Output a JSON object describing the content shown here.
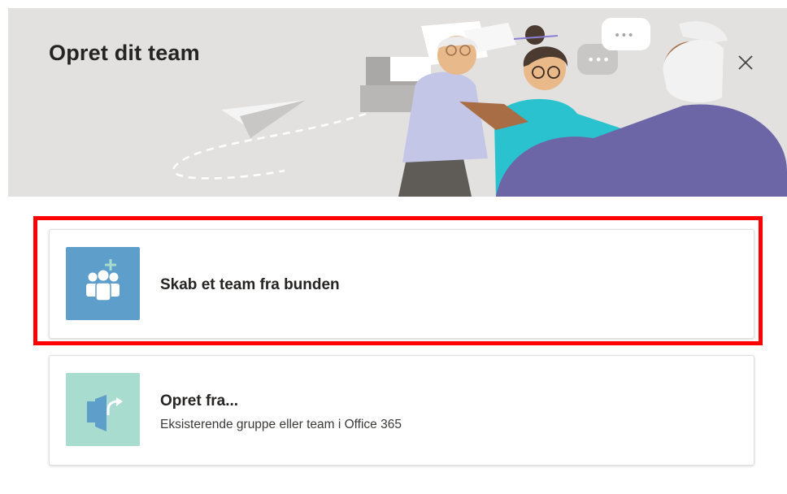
{
  "dialog": {
    "title": "Opret dit team",
    "close_icon": "close-icon",
    "header_background": "#e2e1e0"
  },
  "options": [
    {
      "title": "Skab et team fra bunden",
      "icon": "people-plus-icon",
      "tile_color": "#5e9ecb",
      "highlighted": true
    },
    {
      "title": "Opret fra...",
      "subtitle": "Eksisterende gruppe eller team i Office 365",
      "icon": "import-arrow-icon",
      "tile_color": "#a8dccf"
    }
  ],
  "highlight_color": "#fe0000"
}
